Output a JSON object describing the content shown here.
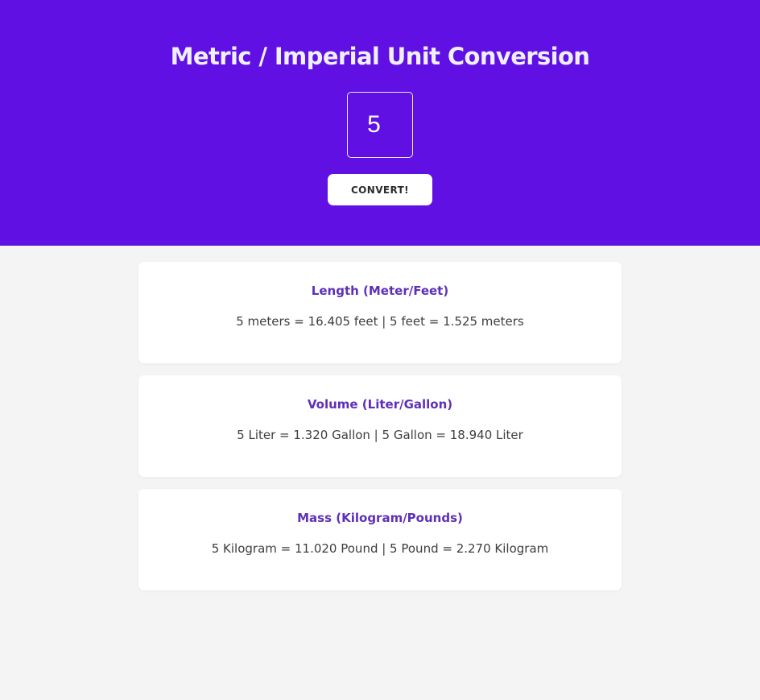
{
  "header": {
    "title": "Metric / Imperial Unit Conversion",
    "input_value": "5",
    "button_label": "CONVERT!"
  },
  "results": [
    {
      "title": "Length (Meter/Feet)",
      "text": "5 meters = 16.405 feet | 5 feet = 1.525 meters"
    },
    {
      "title": "Volume (Liter/Gallon)",
      "text": "5 Liter = 1.320 Gallon | 5 Gallon = 18.940 Liter"
    },
    {
      "title": "Mass (Kilogram/Pounds)",
      "text": "5 Kilogram = 11.020 Pound | 5 Pound = 2.270 Kilogram"
    }
  ],
  "colors": {
    "header_bg": "#6010e3",
    "page_bg": "#f4f4f4",
    "card_title": "#5e30b8"
  }
}
